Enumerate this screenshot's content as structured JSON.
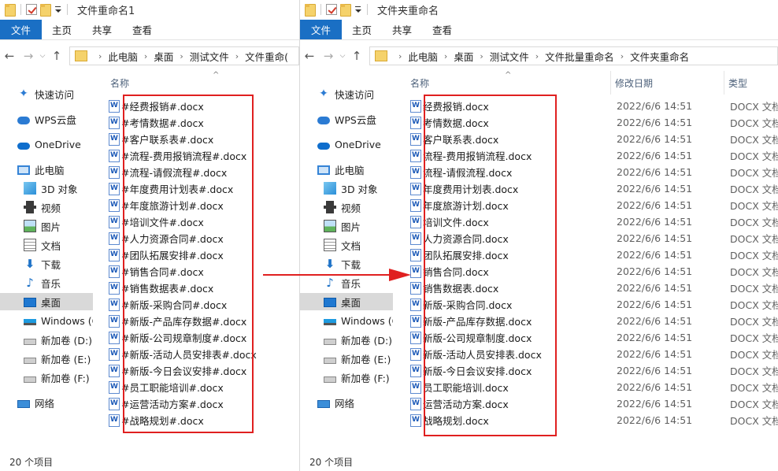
{
  "left": {
    "title": "文件重命名1",
    "ribbon": [
      "文件",
      "主页",
      "共享",
      "查看"
    ],
    "breadcrumb": [
      "此电脑",
      "桌面",
      "测试文件",
      "文件重命("
    ],
    "nav": [
      {
        "label": "快速访问",
        "icon": "star-icon"
      },
      {
        "label": "WPS云盘",
        "icon": "cloud-icon"
      },
      {
        "label": "OneDrive",
        "icon": "onedrive-icon"
      },
      {
        "label": "此电脑",
        "icon": "computer-icon"
      },
      {
        "label": "3D 对象",
        "icon": "3d-objects-icon"
      },
      {
        "label": "视频",
        "icon": "video-icon"
      },
      {
        "label": "图片",
        "icon": "pictures-icon"
      },
      {
        "label": "文档",
        "icon": "documents-icon"
      },
      {
        "label": "下载",
        "icon": "download-icon"
      },
      {
        "label": "音乐",
        "icon": "music-icon"
      },
      {
        "label": "桌面",
        "icon": "desktop-icon",
        "selected": true
      },
      {
        "label": "Windows (C",
        "icon": "windows-drive-icon"
      },
      {
        "label": "新加卷 (D:)",
        "icon": "drive-icon"
      },
      {
        "label": "新加卷 (E:)",
        "icon": "drive-icon"
      },
      {
        "label": "新加卷 (F:)",
        "icon": "drive-icon"
      },
      {
        "label": "网络",
        "icon": "network-icon"
      }
    ],
    "columns": {
      "name": "名称"
    },
    "files": [
      "#经费报销#.docx",
      "#考情数据#.docx",
      "#客户联系表#.docx",
      "#流程-费用报销流程#.docx",
      "#流程-请假流程#.docx",
      "#年度费用计划表#.docx",
      "#年度旅游计划#.docx",
      "#培训文件#.docx",
      "#人力资源合同#.docx",
      "#团队拓展安排#.docx",
      "#销售合同#.docx",
      "#销售数据表#.docx",
      "#新版-采购合同#.docx",
      "#新版-产品库存数据#.docx",
      "#新版-公司规章制度#.docx",
      "#新版-活动人员安排表#.docx",
      "#新版-今日会议安排#.docx",
      "#员工职能培训#.docx",
      "#运营活动方案#.docx",
      "#战略规划#.docx"
    ],
    "status": "20 个项目"
  },
  "right": {
    "title": "文件夹重命名",
    "ribbon": [
      "文件",
      "主页",
      "共享",
      "查看"
    ],
    "breadcrumb": [
      "此电脑",
      "桌面",
      "测试文件",
      "文件批量重命名",
      "文件夹重命名"
    ],
    "nav": [
      {
        "label": "快速访问",
        "icon": "star-icon"
      },
      {
        "label": "WPS云盘",
        "icon": "cloud-icon"
      },
      {
        "label": "OneDrive",
        "icon": "onedrive-icon"
      },
      {
        "label": "此电脑",
        "icon": "computer-icon"
      },
      {
        "label": "3D 对象",
        "icon": "3d-objects-icon"
      },
      {
        "label": "视频",
        "icon": "video-icon"
      },
      {
        "label": "图片",
        "icon": "pictures-icon"
      },
      {
        "label": "文档",
        "icon": "documents-icon"
      },
      {
        "label": "下载",
        "icon": "download-icon"
      },
      {
        "label": "音乐",
        "icon": "music-icon"
      },
      {
        "label": "桌面",
        "icon": "desktop-icon",
        "selected": true
      },
      {
        "label": "Windows (C",
        "icon": "windows-drive-icon"
      },
      {
        "label": "新加卷 (D:)",
        "icon": "drive-icon"
      },
      {
        "label": "新加卷 (E:)",
        "icon": "drive-icon"
      },
      {
        "label": "新加卷 (F:)",
        "icon": "drive-icon"
      },
      {
        "label": "网络",
        "icon": "network-icon"
      }
    ],
    "columns": {
      "name": "名称",
      "date": "修改日期",
      "type": "类型"
    },
    "files": [
      {
        "name": "经费报销.docx",
        "date": "2022/6/6 14:51",
        "type": "DOCX 文档"
      },
      {
        "name": "考情数据.docx",
        "date": "2022/6/6 14:51",
        "type": "DOCX 文档"
      },
      {
        "name": "客户联系表.docx",
        "date": "2022/6/6 14:51",
        "type": "DOCX 文档"
      },
      {
        "name": "流程-费用报销流程.docx",
        "date": "2022/6/6 14:51",
        "type": "DOCX 文档"
      },
      {
        "name": "流程-请假流程.docx",
        "date": "2022/6/6 14:51",
        "type": "DOCX 文档"
      },
      {
        "name": "年度费用计划表.docx",
        "date": "2022/6/6 14:51",
        "type": "DOCX 文档"
      },
      {
        "name": "年度旅游计划.docx",
        "date": "2022/6/6 14:51",
        "type": "DOCX 文档"
      },
      {
        "name": "培训文件.docx",
        "date": "2022/6/6 14:51",
        "type": "DOCX 文档"
      },
      {
        "name": "人力资源合同.docx",
        "date": "2022/6/6 14:51",
        "type": "DOCX 文档"
      },
      {
        "name": "团队拓展安排.docx",
        "date": "2022/6/6 14:51",
        "type": "DOCX 文档"
      },
      {
        "name": "销售合同.docx",
        "date": "2022/6/6 14:51",
        "type": "DOCX 文档"
      },
      {
        "name": "销售数据表.docx",
        "date": "2022/6/6 14:51",
        "type": "DOCX 文档"
      },
      {
        "name": "新版-采购合同.docx",
        "date": "2022/6/6 14:51",
        "type": "DOCX 文档"
      },
      {
        "name": "新版-产品库存数据.docx",
        "date": "2022/6/6 14:51",
        "type": "DOCX 文档"
      },
      {
        "name": "新版-公司规章制度.docx",
        "date": "2022/6/6 14:51",
        "type": "DOCX 文档"
      },
      {
        "name": "新版-活动人员安排表.docx",
        "date": "2022/6/6 14:51",
        "type": "DOCX 文档"
      },
      {
        "name": "新版-今日会议安排.docx",
        "date": "2022/6/6 14:51",
        "type": "DOCX 文档"
      },
      {
        "name": "员工职能培训.docx",
        "date": "2022/6/6 14:51",
        "type": "DOCX 文档"
      },
      {
        "name": "运营活动方案.docx",
        "date": "2022/6/6 14:51",
        "type": "DOCX 文档"
      },
      {
        "name": "战略规划.docx",
        "date": "2022/6/6 14:51",
        "type": "DOCX 文档"
      }
    ],
    "status": "20 个项目"
  },
  "annotation": {
    "color": "#e02020"
  },
  "accent": "#1a6fc4"
}
